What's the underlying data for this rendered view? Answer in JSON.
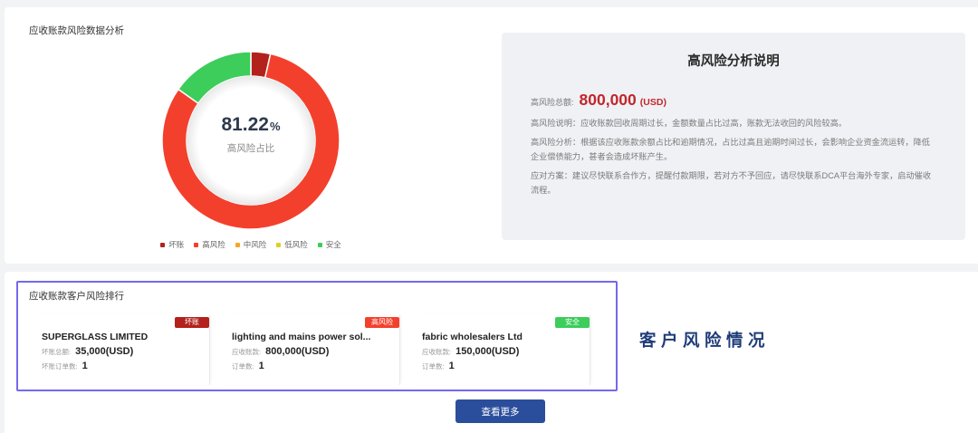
{
  "chart_data": {
    "type": "pie",
    "donut": true,
    "title": "应收账款风险数据分析",
    "categories": [
      "坏账",
      "高风险",
      "中风险",
      "低风险",
      "安全"
    ],
    "values": [
      35000,
      800000,
      0,
      0,
      150000
    ],
    "colors": [
      "#b3211c",
      "#f3402c",
      "#f5a623",
      "#dccf26",
      "#3ccd5b"
    ],
    "center_value": "81.22",
    "center_unit": "%",
    "center_label": "高风险占比",
    "legend_position": "bottom"
  },
  "analysis": {
    "title": "高风险分析说明",
    "total_label": "高风险总额:",
    "total_value": "800,000",
    "total_unit": "(USD)",
    "total_color": "#c1272d",
    "paragraphs": [
      "高风险说明：应收账款回收周期过长，金额数量占比过高，账款无法收回的风险较高。",
      "高风险分析：根据该应收账款余额占比和逾期情况，占比过高且逾期时间过长，会影响企业资金流运转，降低企业偿债能力，甚者会造成坏账产生。",
      "应对方案：建议尽快联系合作方，提醒付款期限，若对方不予回应，请尽快联系DCA平台海外专家，启动催收流程。"
    ]
  },
  "ranking": {
    "title": "应收账款客户风险排行",
    "customers": [
      {
        "badge": "坏账",
        "badge_color": "#b3211c",
        "name": "SUPERGLASS LIMITED",
        "amount_label": "坏账总额:",
        "amount": "35,000(USD)",
        "orders_label": "坏账订单数:",
        "orders": "1"
      },
      {
        "badge": "高风险",
        "badge_color": "#f3402c",
        "name": "lighting and mains power sol...",
        "amount_label": "应收账款:",
        "amount": "800,000(USD)",
        "orders_label": "订单数:",
        "orders": "1"
      },
      {
        "badge": "安全",
        "badge_color": "#3ccd5b",
        "name": "fabric wholesalers Ltd",
        "amount_label": "应收账款:",
        "amount": "150,000(USD)",
        "orders_label": "订单数:",
        "orders": "1"
      }
    ],
    "highlight_color": "#7468ee",
    "side_label": "客户风险情况",
    "side_label_color": "#1f3c78",
    "more_button": "查看更多",
    "button_color": "#2b4e9c"
  }
}
